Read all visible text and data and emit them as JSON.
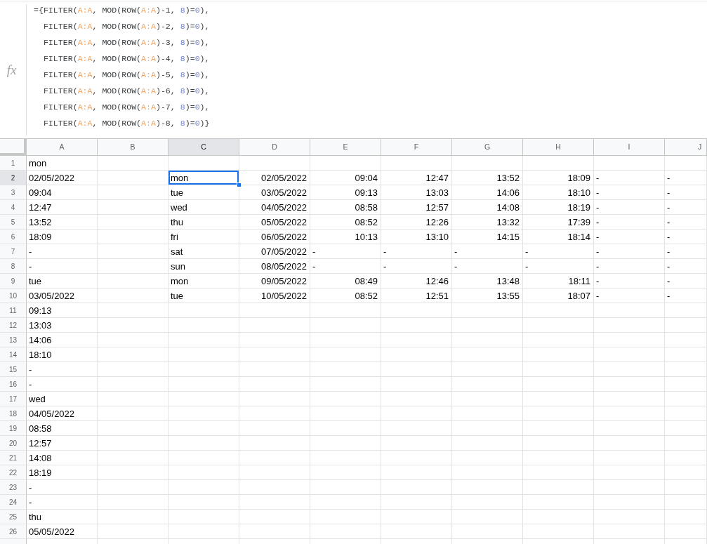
{
  "formula_bar": {
    "label": "fx",
    "lines": [
      [
        {
          "kind": "plain",
          "text": "={FILTER("
        },
        {
          "kind": "range",
          "text": "A:A"
        },
        {
          "kind": "plain",
          "text": ", MOD(ROW("
        },
        {
          "kind": "range",
          "text": "A:A"
        },
        {
          "kind": "plain",
          "text": ")-1, "
        },
        {
          "kind": "number",
          "text": "8"
        },
        {
          "kind": "plain",
          "text": ")="
        },
        {
          "kind": "number",
          "text": "0"
        },
        {
          "kind": "plain",
          "text": "),"
        }
      ],
      [
        {
          "kind": "plain",
          "text": "  FILTER("
        },
        {
          "kind": "range",
          "text": "A:A"
        },
        {
          "kind": "plain",
          "text": ", MOD(ROW("
        },
        {
          "kind": "range",
          "text": "A:A"
        },
        {
          "kind": "plain",
          "text": ")-2, "
        },
        {
          "kind": "number",
          "text": "8"
        },
        {
          "kind": "plain",
          "text": ")="
        },
        {
          "kind": "number",
          "text": "0"
        },
        {
          "kind": "plain",
          "text": "),"
        }
      ],
      [
        {
          "kind": "plain",
          "text": "  FILTER("
        },
        {
          "kind": "range",
          "text": "A:A"
        },
        {
          "kind": "plain",
          "text": ", MOD(ROW("
        },
        {
          "kind": "range",
          "text": "A:A"
        },
        {
          "kind": "plain",
          "text": ")-3, "
        },
        {
          "kind": "number",
          "text": "8"
        },
        {
          "kind": "plain",
          "text": ")="
        },
        {
          "kind": "number",
          "text": "0"
        },
        {
          "kind": "plain",
          "text": "),"
        }
      ],
      [
        {
          "kind": "plain",
          "text": "  FILTER("
        },
        {
          "kind": "range",
          "text": "A:A"
        },
        {
          "kind": "plain",
          "text": ", MOD(ROW("
        },
        {
          "kind": "range",
          "text": "A:A"
        },
        {
          "kind": "plain",
          "text": ")-4, "
        },
        {
          "kind": "number",
          "text": "8"
        },
        {
          "kind": "plain",
          "text": ")="
        },
        {
          "kind": "number",
          "text": "0"
        },
        {
          "kind": "plain",
          "text": "),"
        }
      ],
      [
        {
          "kind": "plain",
          "text": "  FILTER("
        },
        {
          "kind": "range",
          "text": "A:A"
        },
        {
          "kind": "plain",
          "text": ", MOD(ROW("
        },
        {
          "kind": "range",
          "text": "A:A"
        },
        {
          "kind": "plain",
          "text": ")-5, "
        },
        {
          "kind": "number",
          "text": "8"
        },
        {
          "kind": "plain",
          "text": ")="
        },
        {
          "kind": "number",
          "text": "0"
        },
        {
          "kind": "plain",
          "text": "),"
        }
      ],
      [
        {
          "kind": "plain",
          "text": "  FILTER("
        },
        {
          "kind": "range",
          "text": "A:A"
        },
        {
          "kind": "plain",
          "text": ", MOD(ROW("
        },
        {
          "kind": "range",
          "text": "A:A"
        },
        {
          "kind": "plain",
          "text": ")-6, "
        },
        {
          "kind": "number",
          "text": "8"
        },
        {
          "kind": "plain",
          "text": ")="
        },
        {
          "kind": "number",
          "text": "0"
        },
        {
          "kind": "plain",
          "text": "),"
        }
      ],
      [
        {
          "kind": "plain",
          "text": "  FILTER("
        },
        {
          "kind": "range",
          "text": "A:A"
        },
        {
          "kind": "plain",
          "text": ", MOD(ROW("
        },
        {
          "kind": "range",
          "text": "A:A"
        },
        {
          "kind": "plain",
          "text": ")-7, "
        },
        {
          "kind": "number",
          "text": "8"
        },
        {
          "kind": "plain",
          "text": ")="
        },
        {
          "kind": "number",
          "text": "0"
        },
        {
          "kind": "plain",
          "text": "),"
        }
      ],
      [
        {
          "kind": "plain",
          "text": "  FILTER("
        },
        {
          "kind": "range",
          "text": "A:A"
        },
        {
          "kind": "plain",
          "text": ", MOD(ROW("
        },
        {
          "kind": "range",
          "text": "A:A"
        },
        {
          "kind": "plain",
          "text": ")-8, "
        },
        {
          "kind": "number",
          "text": "8"
        },
        {
          "kind": "plain",
          "text": ")="
        },
        {
          "kind": "number",
          "text": "0"
        },
        {
          "kind": "plain",
          "text": ")}"
        }
      ]
    ]
  },
  "sheet": {
    "columns": [
      {
        "label": "A",
        "selected": false
      },
      {
        "label": "B",
        "selected": false
      },
      {
        "label": "C",
        "selected": true
      },
      {
        "label": "D",
        "selected": false
      },
      {
        "label": "E",
        "selected": false
      },
      {
        "label": "F",
        "selected": false
      },
      {
        "label": "G",
        "selected": false
      },
      {
        "label": "H",
        "selected": false
      },
      {
        "label": "I",
        "selected": false
      },
      {
        "label": "J",
        "selected": false
      }
    ],
    "rows": [
      {
        "number": "1",
        "selected": false,
        "cells": [
          {
            "kind": "text",
            "text": "mon"
          }
        ]
      },
      {
        "number": "2",
        "selected": true,
        "cells": [
          {
            "kind": "text",
            "text": "02/05/2022"
          },
          {
            "kind": "empty"
          },
          {
            "kind": "text",
            "text": "mon"
          },
          {
            "kind": "number",
            "text": "02/05/2022"
          },
          {
            "kind": "number",
            "text": "09:04"
          },
          {
            "kind": "number",
            "text": "12:47"
          },
          {
            "kind": "number",
            "text": "13:52"
          },
          {
            "kind": "number",
            "text": "18:09"
          },
          {
            "kind": "text",
            "text": "-"
          },
          {
            "kind": "text",
            "text": "-"
          }
        ]
      },
      {
        "number": "3",
        "selected": false,
        "cells": [
          {
            "kind": "text",
            "text": "09:04"
          },
          {
            "kind": "empty"
          },
          {
            "kind": "text",
            "text": "tue"
          },
          {
            "kind": "number",
            "text": "03/05/2022"
          },
          {
            "kind": "number",
            "text": "09:13"
          },
          {
            "kind": "number",
            "text": "13:03"
          },
          {
            "kind": "number",
            "text": "14:06"
          },
          {
            "kind": "number",
            "text": "18:10"
          },
          {
            "kind": "text",
            "text": "-"
          },
          {
            "kind": "text",
            "text": "-"
          }
        ]
      },
      {
        "number": "4",
        "selected": false,
        "cells": [
          {
            "kind": "text",
            "text": "12:47"
          },
          {
            "kind": "empty"
          },
          {
            "kind": "text",
            "text": "wed"
          },
          {
            "kind": "number",
            "text": "04/05/2022"
          },
          {
            "kind": "number",
            "text": "08:58"
          },
          {
            "kind": "number",
            "text": "12:57"
          },
          {
            "kind": "number",
            "text": "14:08"
          },
          {
            "kind": "number",
            "text": "18:19"
          },
          {
            "kind": "text",
            "text": "-"
          },
          {
            "kind": "text",
            "text": "-"
          }
        ]
      },
      {
        "number": "5",
        "selected": false,
        "cells": [
          {
            "kind": "text",
            "text": "13:52"
          },
          {
            "kind": "empty"
          },
          {
            "kind": "text",
            "text": "thu"
          },
          {
            "kind": "number",
            "text": "05/05/2022"
          },
          {
            "kind": "number",
            "text": "08:52"
          },
          {
            "kind": "number",
            "text": "12:26"
          },
          {
            "kind": "number",
            "text": "13:32"
          },
          {
            "kind": "number",
            "text": "17:39"
          },
          {
            "kind": "text",
            "text": "-"
          },
          {
            "kind": "text",
            "text": "-"
          }
        ]
      },
      {
        "number": "6",
        "selected": false,
        "cells": [
          {
            "kind": "text",
            "text": "18:09"
          },
          {
            "kind": "empty"
          },
          {
            "kind": "text",
            "text": "fri"
          },
          {
            "kind": "number",
            "text": "06/05/2022"
          },
          {
            "kind": "number",
            "text": "10:13"
          },
          {
            "kind": "number",
            "text": "13:10"
          },
          {
            "kind": "number",
            "text": "14:15"
          },
          {
            "kind": "number",
            "text": "18:14"
          },
          {
            "kind": "text",
            "text": "-"
          },
          {
            "kind": "text",
            "text": "-"
          }
        ]
      },
      {
        "number": "7",
        "selected": false,
        "cells": [
          {
            "kind": "text",
            "text": "-"
          },
          {
            "kind": "empty"
          },
          {
            "kind": "text",
            "text": "sat"
          },
          {
            "kind": "number",
            "text": "07/05/2022"
          },
          {
            "kind": "text",
            "text": "-"
          },
          {
            "kind": "text",
            "text": "-"
          },
          {
            "kind": "text",
            "text": "-"
          },
          {
            "kind": "text",
            "text": "-"
          },
          {
            "kind": "text",
            "text": "-"
          },
          {
            "kind": "text",
            "text": "-"
          }
        ]
      },
      {
        "number": "8",
        "selected": false,
        "cells": [
          {
            "kind": "text",
            "text": "-"
          },
          {
            "kind": "empty"
          },
          {
            "kind": "text",
            "text": "sun"
          },
          {
            "kind": "number",
            "text": "08/05/2022"
          },
          {
            "kind": "text",
            "text": "-"
          },
          {
            "kind": "text",
            "text": "-"
          },
          {
            "kind": "text",
            "text": "-"
          },
          {
            "kind": "text",
            "text": "-"
          },
          {
            "kind": "text",
            "text": "-"
          },
          {
            "kind": "text",
            "text": "-"
          }
        ]
      },
      {
        "number": "9",
        "selected": false,
        "cells": [
          {
            "kind": "text",
            "text": "tue"
          },
          {
            "kind": "empty"
          },
          {
            "kind": "text",
            "text": "mon"
          },
          {
            "kind": "number",
            "text": "09/05/2022"
          },
          {
            "kind": "number",
            "text": "08:49"
          },
          {
            "kind": "number",
            "text": "12:46"
          },
          {
            "kind": "number",
            "text": "13:48"
          },
          {
            "kind": "number",
            "text": "18:11"
          },
          {
            "kind": "text",
            "text": "-"
          },
          {
            "kind": "text",
            "text": "-"
          }
        ]
      },
      {
        "number": "10",
        "selected": false,
        "cells": [
          {
            "kind": "text",
            "text": "03/05/2022"
          },
          {
            "kind": "empty"
          },
          {
            "kind": "text",
            "text": "tue"
          },
          {
            "kind": "number",
            "text": "10/05/2022"
          },
          {
            "kind": "number",
            "text": "08:52"
          },
          {
            "kind": "number",
            "text": "12:51"
          },
          {
            "kind": "number",
            "text": "13:55"
          },
          {
            "kind": "number",
            "text": "18:07"
          },
          {
            "kind": "text",
            "text": "-"
          },
          {
            "kind": "text",
            "text": "-"
          }
        ]
      },
      {
        "number": "11",
        "selected": false,
        "cells": [
          {
            "kind": "text",
            "text": "09:13"
          }
        ]
      },
      {
        "number": "12",
        "selected": false,
        "cells": [
          {
            "kind": "text",
            "text": "13:03"
          }
        ]
      },
      {
        "number": "13",
        "selected": false,
        "cells": [
          {
            "kind": "text",
            "text": "14:06"
          }
        ]
      },
      {
        "number": "14",
        "selected": false,
        "cells": [
          {
            "kind": "text",
            "text": "18:10"
          }
        ]
      },
      {
        "number": "15",
        "selected": false,
        "cells": [
          {
            "kind": "text",
            "text": "-"
          }
        ]
      },
      {
        "number": "16",
        "selected": false,
        "cells": [
          {
            "kind": "text",
            "text": "-"
          }
        ]
      },
      {
        "number": "17",
        "selected": false,
        "cells": [
          {
            "kind": "text",
            "text": "wed"
          }
        ]
      },
      {
        "number": "18",
        "selected": false,
        "cells": [
          {
            "kind": "text",
            "text": "04/05/2022"
          }
        ]
      },
      {
        "number": "19",
        "selected": false,
        "cells": [
          {
            "kind": "text",
            "text": "08:58"
          }
        ]
      },
      {
        "number": "20",
        "selected": false,
        "cells": [
          {
            "kind": "text",
            "text": "12:57"
          }
        ]
      },
      {
        "number": "21",
        "selected": false,
        "cells": [
          {
            "kind": "text",
            "text": "14:08"
          }
        ]
      },
      {
        "number": "22",
        "selected": false,
        "cells": [
          {
            "kind": "text",
            "text": "18:19"
          }
        ]
      },
      {
        "number": "23",
        "selected": false,
        "cells": [
          {
            "kind": "text",
            "text": "-"
          }
        ]
      },
      {
        "number": "24",
        "selected": false,
        "cells": [
          {
            "kind": "text",
            "text": "-"
          }
        ]
      },
      {
        "number": "25",
        "selected": false,
        "cells": [
          {
            "kind": "text",
            "text": "thu"
          }
        ]
      },
      {
        "number": "26",
        "selected": false,
        "cells": [
          {
            "kind": "text",
            "text": "05/05/2022"
          }
        ]
      }
    ]
  }
}
